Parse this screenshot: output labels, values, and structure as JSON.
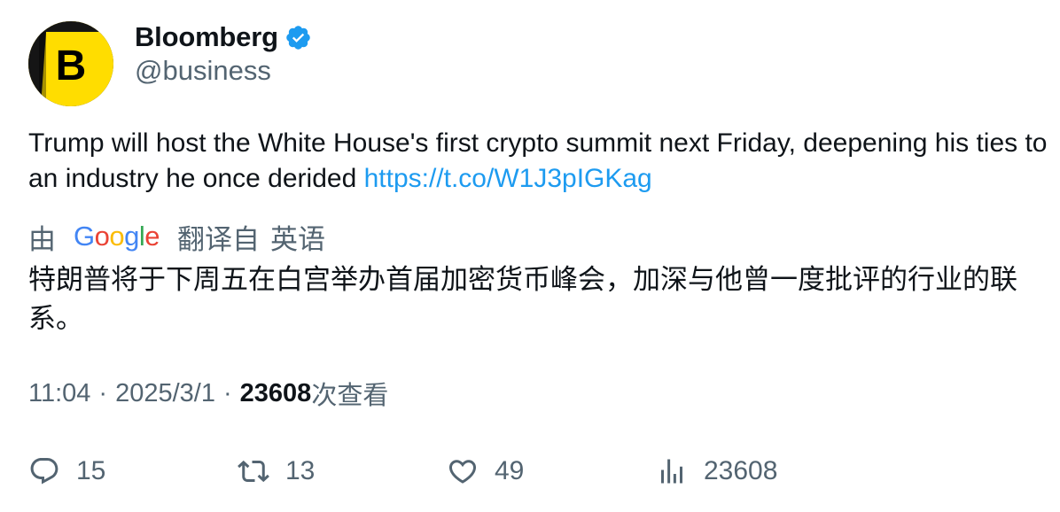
{
  "author": {
    "name": "Bloomberg",
    "handle": "@business",
    "avatar_letter": "B",
    "verified_icon": "verified-badge-icon"
  },
  "tweet": {
    "text": "Trump will host the White House's first crypto summit next Friday, deepening his ties to an industry he once derided ",
    "link": "https://t.co/W1J3pIGKag"
  },
  "translation": {
    "prefix": "由",
    "provider": "Google",
    "suffix": "翻译自",
    "language": "英语",
    "text": "特朗普将于下周五在白宫举办首届加密货币峰会，加深与他曾一度批评的行业的联系。"
  },
  "meta": {
    "time": "11:04",
    "separator": "·",
    "date": "2025/3/1",
    "views_count": "23608",
    "views_label": "次查看"
  },
  "actions": {
    "reply_count": "15",
    "retweet_count": "13",
    "like_count": "49",
    "views_count": "23608"
  },
  "colors": {
    "link": "#1d9bf0",
    "secondary": "#536471",
    "primary": "#0f1419",
    "avatar_yellow": "#ffdd00",
    "verified_blue": "#1d9bf0"
  }
}
